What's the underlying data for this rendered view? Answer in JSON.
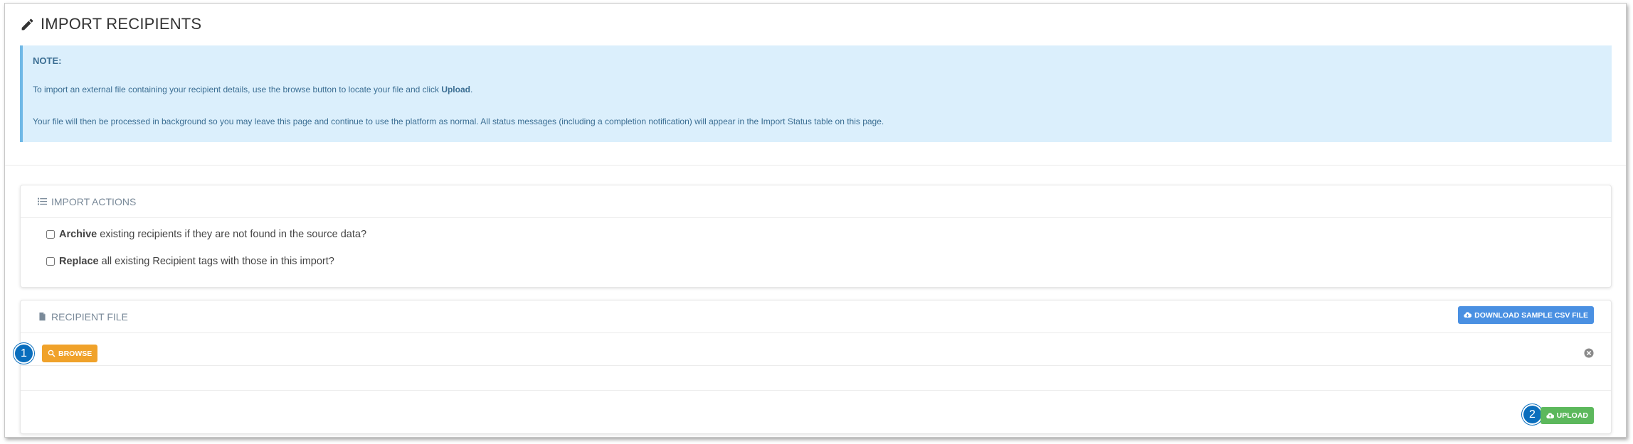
{
  "page": {
    "title": "IMPORT RECIPIENTS",
    "icon": "pencil-icon"
  },
  "note": {
    "title": "NOTE:",
    "line1_prefix": "To import an external file containing your recipient details, use the browse button to locate your file and click ",
    "line1_bold": "Upload",
    "line1_suffix": ".",
    "line2": "Your file will then be processed in background so you may leave this page and continue to use the platform as normal. All status messages (including a completion notification) will appear in the Import Status table on this page."
  },
  "import_actions": {
    "heading": "IMPORT ACTIONS",
    "icon": "list-icon",
    "options": [
      {
        "bold": "Archive",
        "text": "existing recipients if they are not found in the source data?",
        "checked": false
      },
      {
        "bold": "Replace",
        "text": "all existing Recipient tags with those in this import?",
        "checked": false
      }
    ]
  },
  "recipient_file": {
    "heading": "RECIPIENT FILE",
    "icon": "file-icon",
    "download_label": "DOWNLOAD SAMPLE CSV FILE",
    "browse_label": "BROWSE",
    "upload_label": "UPLOAD",
    "step1": "1",
    "step2": "2"
  },
  "colors": {
    "note_bg": "#dbeffc",
    "note_border": "#6fb8e6",
    "download": "#4a90e2",
    "browse": "#f0a22a",
    "upload": "#5cb85c",
    "step_badge": "#0a6ebd"
  }
}
